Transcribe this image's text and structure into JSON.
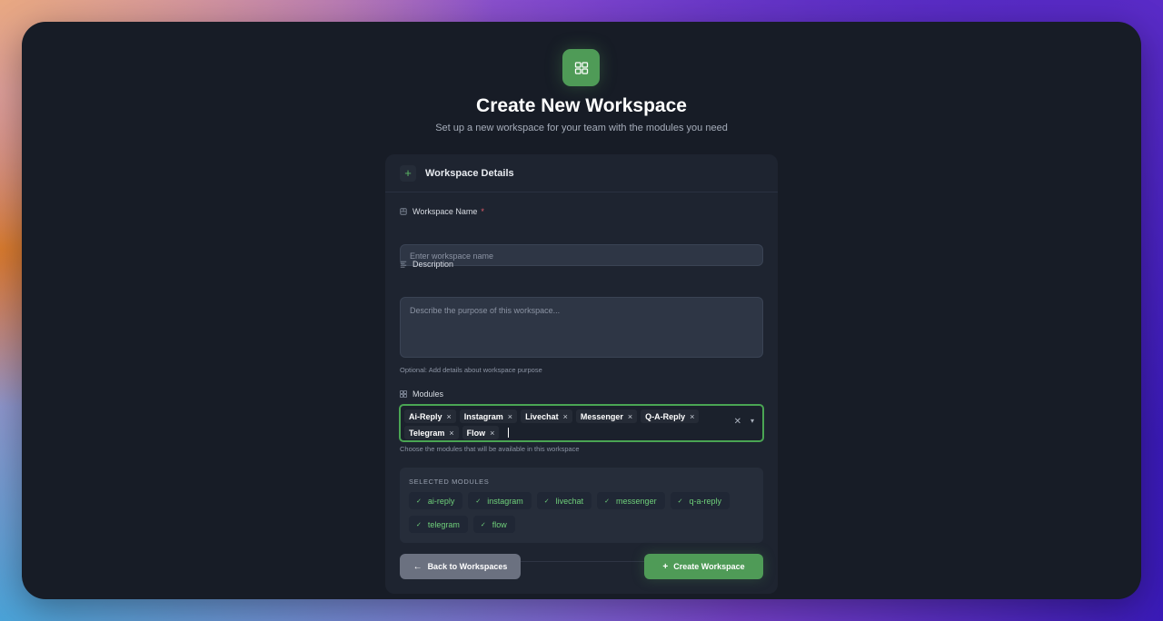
{
  "header": {
    "title": "Create New Workspace",
    "subtitle": "Set up a new workspace for your team with the modules you need",
    "logo_icon": "layout-grid-icon"
  },
  "card": {
    "title": "Workspace Details",
    "plus": "+"
  },
  "form": {
    "name_label": "Workspace Name",
    "name_required": "*",
    "name_placeholder": "Enter workspace name",
    "description_label": "Description",
    "description_placeholder": "Describe the purpose of this workspace...",
    "description_helper": "Optional: Add details about workspace purpose",
    "modules_label": "Modules",
    "modules_helper": "Choose the modules that will be available in this workspace",
    "module_chips": [
      "Ai-Reply",
      "Instagram",
      "Livechat",
      "Messenger",
      "Q-A-Reply",
      "Telegram",
      "Flow"
    ],
    "chip_remove": "×",
    "clear": "✕",
    "dropdown": "▾"
  },
  "selected": {
    "title": "SELECTED MODULES",
    "check": "✓",
    "items": [
      "ai-reply",
      "instagram",
      "livechat",
      "messenger",
      "q-a-reply",
      "telegram",
      "flow"
    ]
  },
  "actions": {
    "back_label": "Back to Workspaces",
    "back_icon": "←",
    "create_label": "Create Workspace",
    "create_icon": "+"
  },
  "colors": {
    "accent": "#4f9b57",
    "background": "#171c26",
    "card": "#1e2430",
    "required": "#e35d6a"
  }
}
